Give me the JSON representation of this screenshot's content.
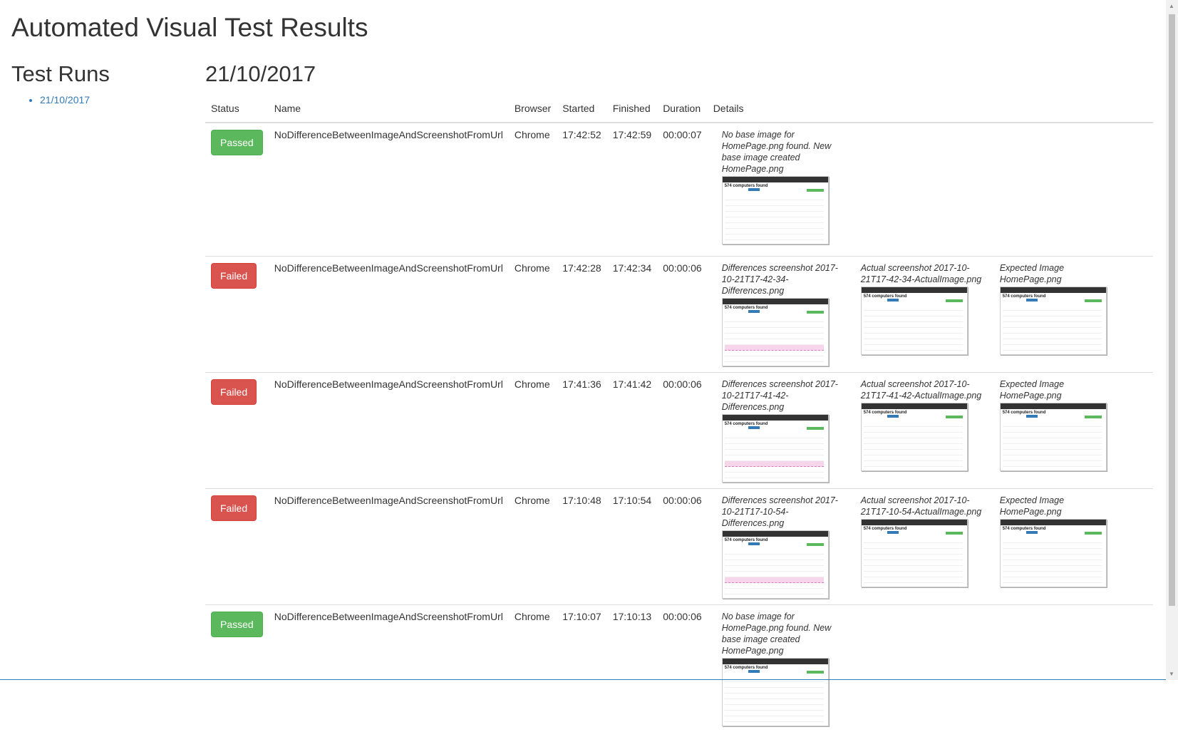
{
  "page": {
    "title": "Automated Visual Test Results"
  },
  "sidebar": {
    "heading": "Test Runs",
    "runs": [
      "21/10/2017"
    ]
  },
  "main": {
    "heading": "21/10/2017",
    "columns": [
      "Status",
      "Name",
      "Browser",
      "Started",
      "Finished",
      "Duration",
      "Details"
    ],
    "rows": [
      {
        "status": "Passed",
        "name": "NoDifferenceBetweenImageAndScreenshotFromUrl",
        "browser": "Chrome",
        "started": "17:42:52",
        "finished": "17:42:59",
        "duration": "00:00:07",
        "details": [
          {
            "caption": "No base image for HomePage.png found. New base image created HomePage.png"
          }
        ]
      },
      {
        "status": "Failed",
        "name": "NoDifferenceBetweenImageAndScreenshotFromUrl",
        "browser": "Chrome",
        "started": "17:42:28",
        "finished": "17:42:34",
        "duration": "00:00:06",
        "details": [
          {
            "caption": "Differences screenshot 2017-10-21T17-42-34-Differences.png"
          },
          {
            "caption": "Actual screenshot 2017-10-21T17-42-34-ActualImage.png"
          },
          {
            "caption": "Expected Image HomePage.png"
          }
        ]
      },
      {
        "status": "Failed",
        "name": "NoDifferenceBetweenImageAndScreenshotFromUrl",
        "browser": "Chrome",
        "started": "17:41:36",
        "finished": "17:41:42",
        "duration": "00:00:06",
        "details": [
          {
            "caption": "Differences screenshot 2017-10-21T17-41-42-Differences.png"
          },
          {
            "caption": "Actual screenshot 2017-10-21T17-41-42-ActualImage.png"
          },
          {
            "caption": "Expected Image HomePage.png"
          }
        ]
      },
      {
        "status": "Failed",
        "name": "NoDifferenceBetweenImageAndScreenshotFromUrl",
        "browser": "Chrome",
        "started": "17:10:48",
        "finished": "17:10:54",
        "duration": "00:00:06",
        "details": [
          {
            "caption": "Differences screenshot 2017-10-21T17-10-54-Differences.png"
          },
          {
            "caption": "Actual screenshot 2017-10-21T17-10-54-ActualImage.png"
          },
          {
            "caption": "Expected Image HomePage.png"
          }
        ]
      },
      {
        "status": "Passed",
        "name": "NoDifferenceBetweenImageAndScreenshotFromUrl",
        "browser": "Chrome",
        "started": "17:10:07",
        "finished": "17:10:13",
        "duration": "00:00:06",
        "details": [
          {
            "caption": "No base image for HomePage.png found. New base image created HomePage.png"
          }
        ]
      }
    ],
    "thumbnail_text": "574 computers found"
  },
  "colors": {
    "passed": "#5cb85c",
    "failed": "#d9534f",
    "link": "#337ab7"
  }
}
